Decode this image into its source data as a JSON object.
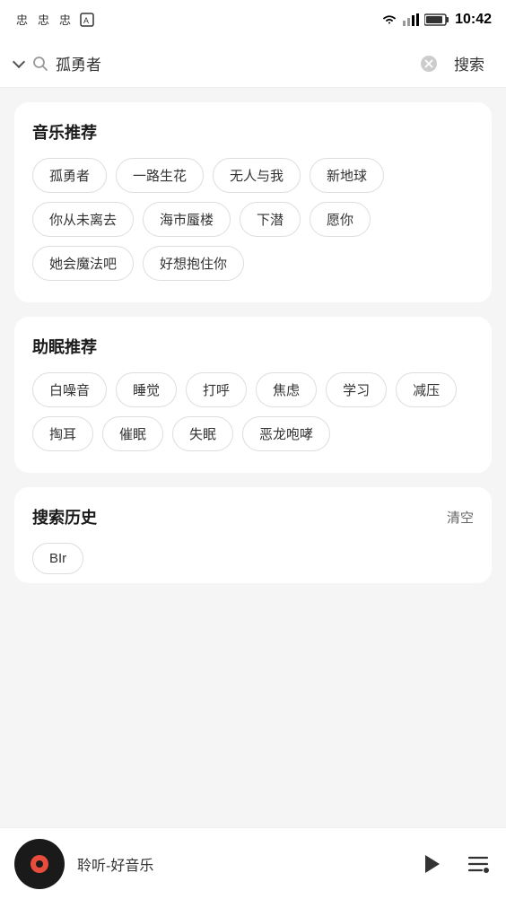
{
  "statusBar": {
    "time": "10:42",
    "icons": [
      "wifi",
      "signal",
      "battery"
    ]
  },
  "search": {
    "query": "孤勇者",
    "placeholder": "搜索",
    "clear_label": "×",
    "search_btn": "搜索"
  },
  "musicSection": {
    "title": "音乐推荐",
    "tags": [
      "孤勇者",
      "一路生花",
      "无人与我",
      "新地球",
      "你从未离去",
      "海市蜃楼",
      "下潜",
      "愿你",
      "她会魔法吧",
      "好想抱住你"
    ]
  },
  "sleepSection": {
    "title": "助眠推荐",
    "tags": [
      "白噪音",
      "睡觉",
      "打呼",
      "焦虑",
      "学习",
      "减压",
      "掏耳",
      "催眠",
      "失眠",
      "恶龙咆哮"
    ]
  },
  "historySection": {
    "title": "搜索历史",
    "clear_label": "清空",
    "items": [
      "BIr"
    ]
  },
  "player": {
    "title": "聆听-好音乐",
    "play_icon": "▶",
    "playlist_icon": "≡"
  }
}
